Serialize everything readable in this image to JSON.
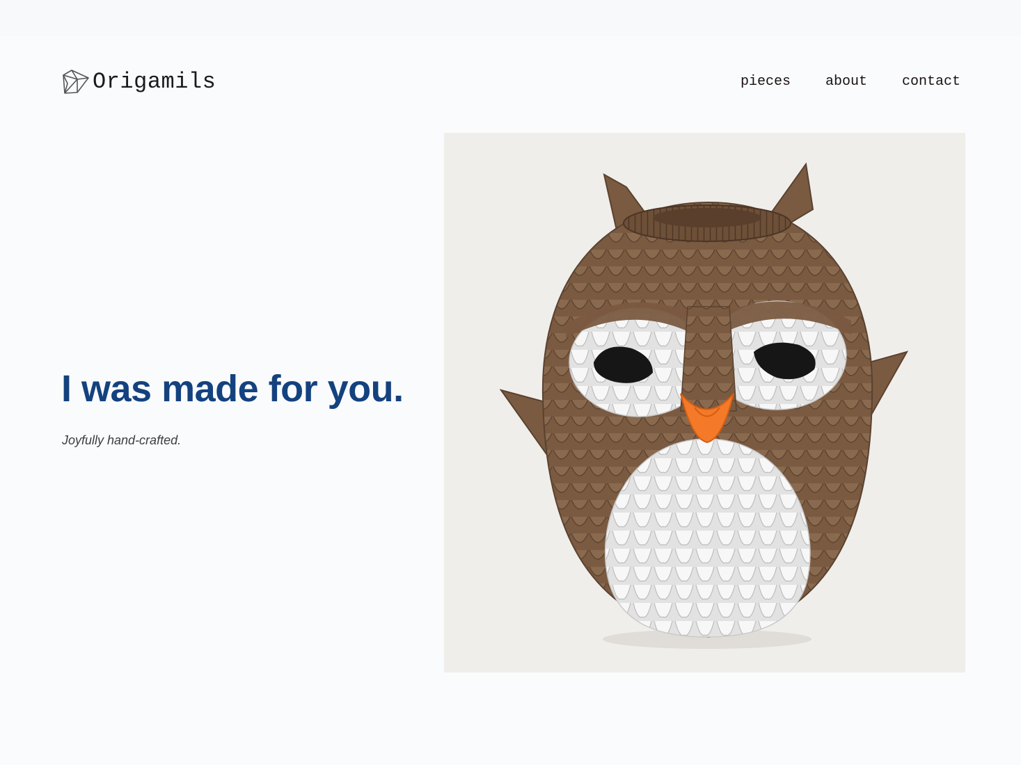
{
  "header": {
    "brand": "Origamils",
    "logo_icon": "origami-gem-icon",
    "nav": [
      {
        "label": "pieces"
      },
      {
        "label": "about"
      },
      {
        "label": "contact"
      }
    ]
  },
  "hero": {
    "title": "I was made for you.",
    "subtitle": "Joyfully hand-crafted.",
    "image": {
      "subject": "origami-owl-image"
    }
  },
  "colors": {
    "background": "#fafbfd",
    "title": "#14427f",
    "text": "#1b1b1b",
    "photo_background": "#f0eeeb",
    "owl_brown": "#7a5a40",
    "owl_white": "#f4f4f4",
    "owl_beak": "#f47a2a"
  }
}
